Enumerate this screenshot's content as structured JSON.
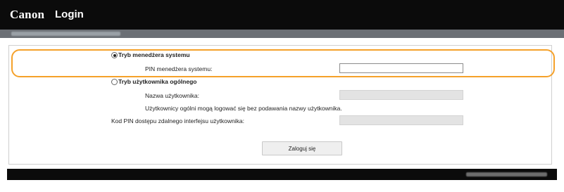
{
  "header": {
    "logo": "Canon",
    "title": "Login"
  },
  "form": {
    "system_manager_mode": {
      "label": "Tryb menedżera systemu",
      "selected": true,
      "pin_label": "PIN menedżera systemu:",
      "pin_value": ""
    },
    "general_user_mode": {
      "label": "Tryb użytkownika ogólnego",
      "selected": false,
      "username_label": "Nazwa użytkownika:",
      "username_value": "",
      "note": "Użytkownicy ogólni mogą logować się bez podawania nazwy użytkownika."
    },
    "remote_ui_pin_label": "Kod PIN dostępu zdalnego interfejsu użytkownika:",
    "remote_ui_pin_value": "",
    "login_button": "Zaloguj się"
  },
  "colors": {
    "highlight": "#f5a12a",
    "header_bg": "#0b0b0b"
  }
}
